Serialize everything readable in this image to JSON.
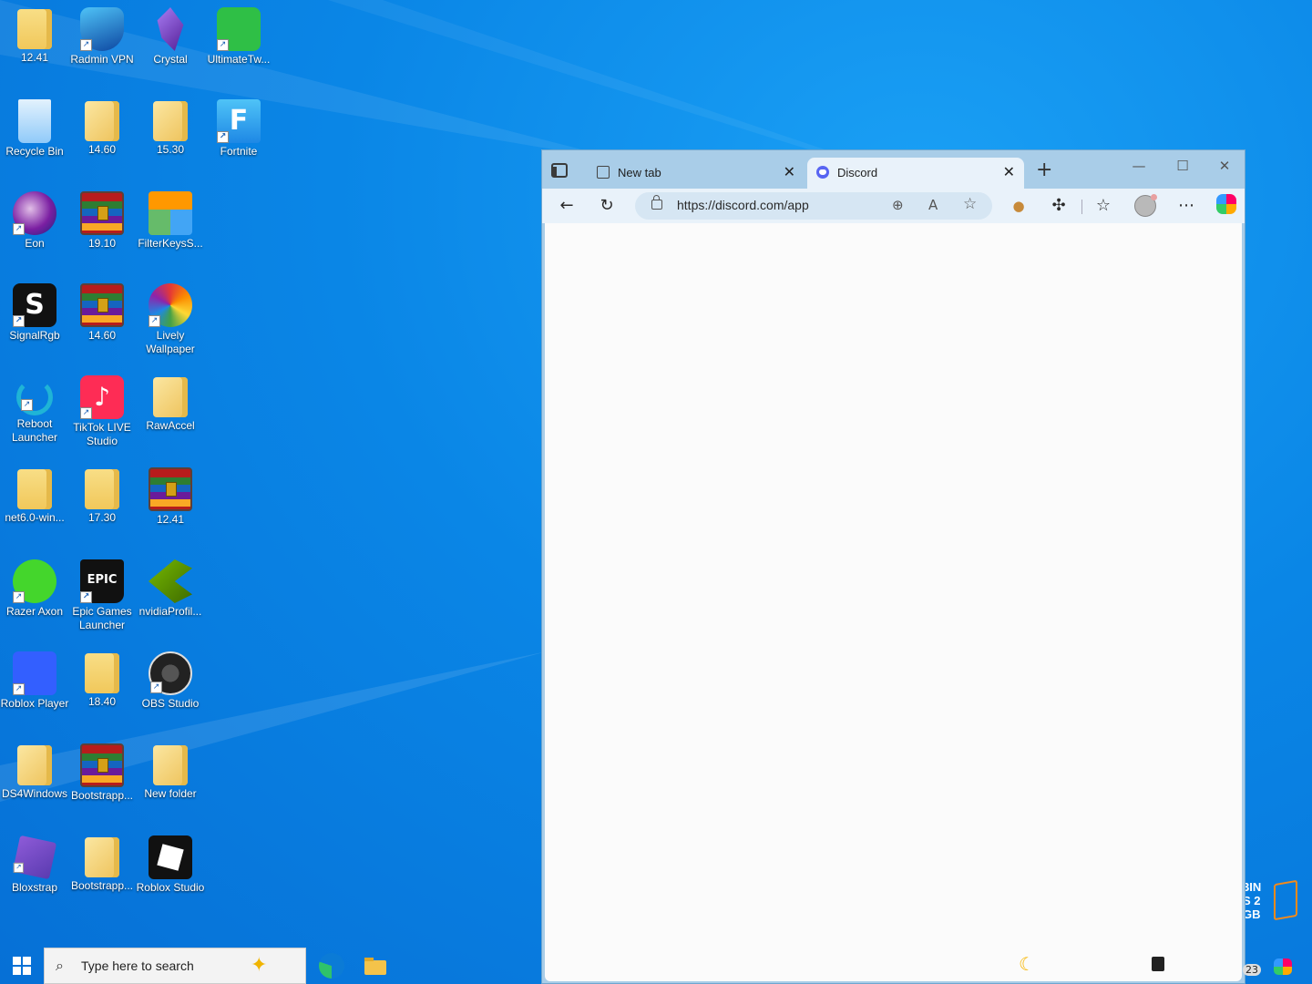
{
  "desktop": {
    "icons": [
      {
        "label": "12.41"
      },
      {
        "label": "Radmin VPN"
      },
      {
        "label": "Crystal"
      },
      {
        "label": "UltimateTw..."
      },
      {
        "label": "Recycle Bin"
      },
      {
        "label": "14.60"
      },
      {
        "label": "15.30"
      },
      {
        "label": "Fortnite"
      },
      {
        "label": "Eon"
      },
      {
        "label": "19.10"
      },
      {
        "label": "FilterKeysS..."
      },
      {
        "label": "SignalRgb"
      },
      {
        "label": "14.60"
      },
      {
        "label": "Lively Wallpaper"
      },
      {
        "label": "Reboot Launcher"
      },
      {
        "label": "TikTok LIVE Studio"
      },
      {
        "label": "RawAccel"
      },
      {
        "label": "net6.0-win..."
      },
      {
        "label": "17.30"
      },
      {
        "label": "12.41"
      },
      {
        "label": "Razer Axon"
      },
      {
        "label": "Epic Games Launcher"
      },
      {
        "label": "nvidiaProfil..."
      },
      {
        "label": "Roblox Player"
      },
      {
        "label": "18.40"
      },
      {
        "label": "OBS Studio"
      },
      {
        "label": "DS4Windows"
      },
      {
        "label": "Bootstrapp..."
      },
      {
        "label": "New folder"
      },
      {
        "label": "Bloxstrap"
      },
      {
        "label": "Bootstrapp..."
      },
      {
        "label": "Roblox Studio"
      }
    ]
  },
  "browser": {
    "tabs": [
      {
        "label": "New tab",
        "active": false
      },
      {
        "label": "Discord",
        "active": true
      }
    ],
    "close_glyph": "✕",
    "add_tab_glyph": "+",
    "url": "https://discord.com/app",
    "window_controls": {
      "minimize": "—",
      "maximize": "☐",
      "close": "✕"
    },
    "icons": [
      "tab-actions-icon",
      "back-icon",
      "refresh-icon",
      "lock-icon",
      "zoom-icon",
      "read-aloud-icon",
      "favorite-star-icon",
      "cookie-icon",
      "extensions-icon",
      "favorites-icon",
      "profile-avatar",
      "more-icon",
      "copilot-icon"
    ]
  },
  "overlay": {
    "promo_lines": [
      "3IN",
      "S 2",
      "GB"
    ]
  },
  "taskbar": {
    "search_placeholder": "Type here to search",
    "notification_count": "23"
  },
  "colors": {
    "desktop_blue": "#0a86e6",
    "browser_frame": "#a9cde8",
    "active_tab": "#e9f2fa",
    "discord_brand": "#5865f2"
  }
}
